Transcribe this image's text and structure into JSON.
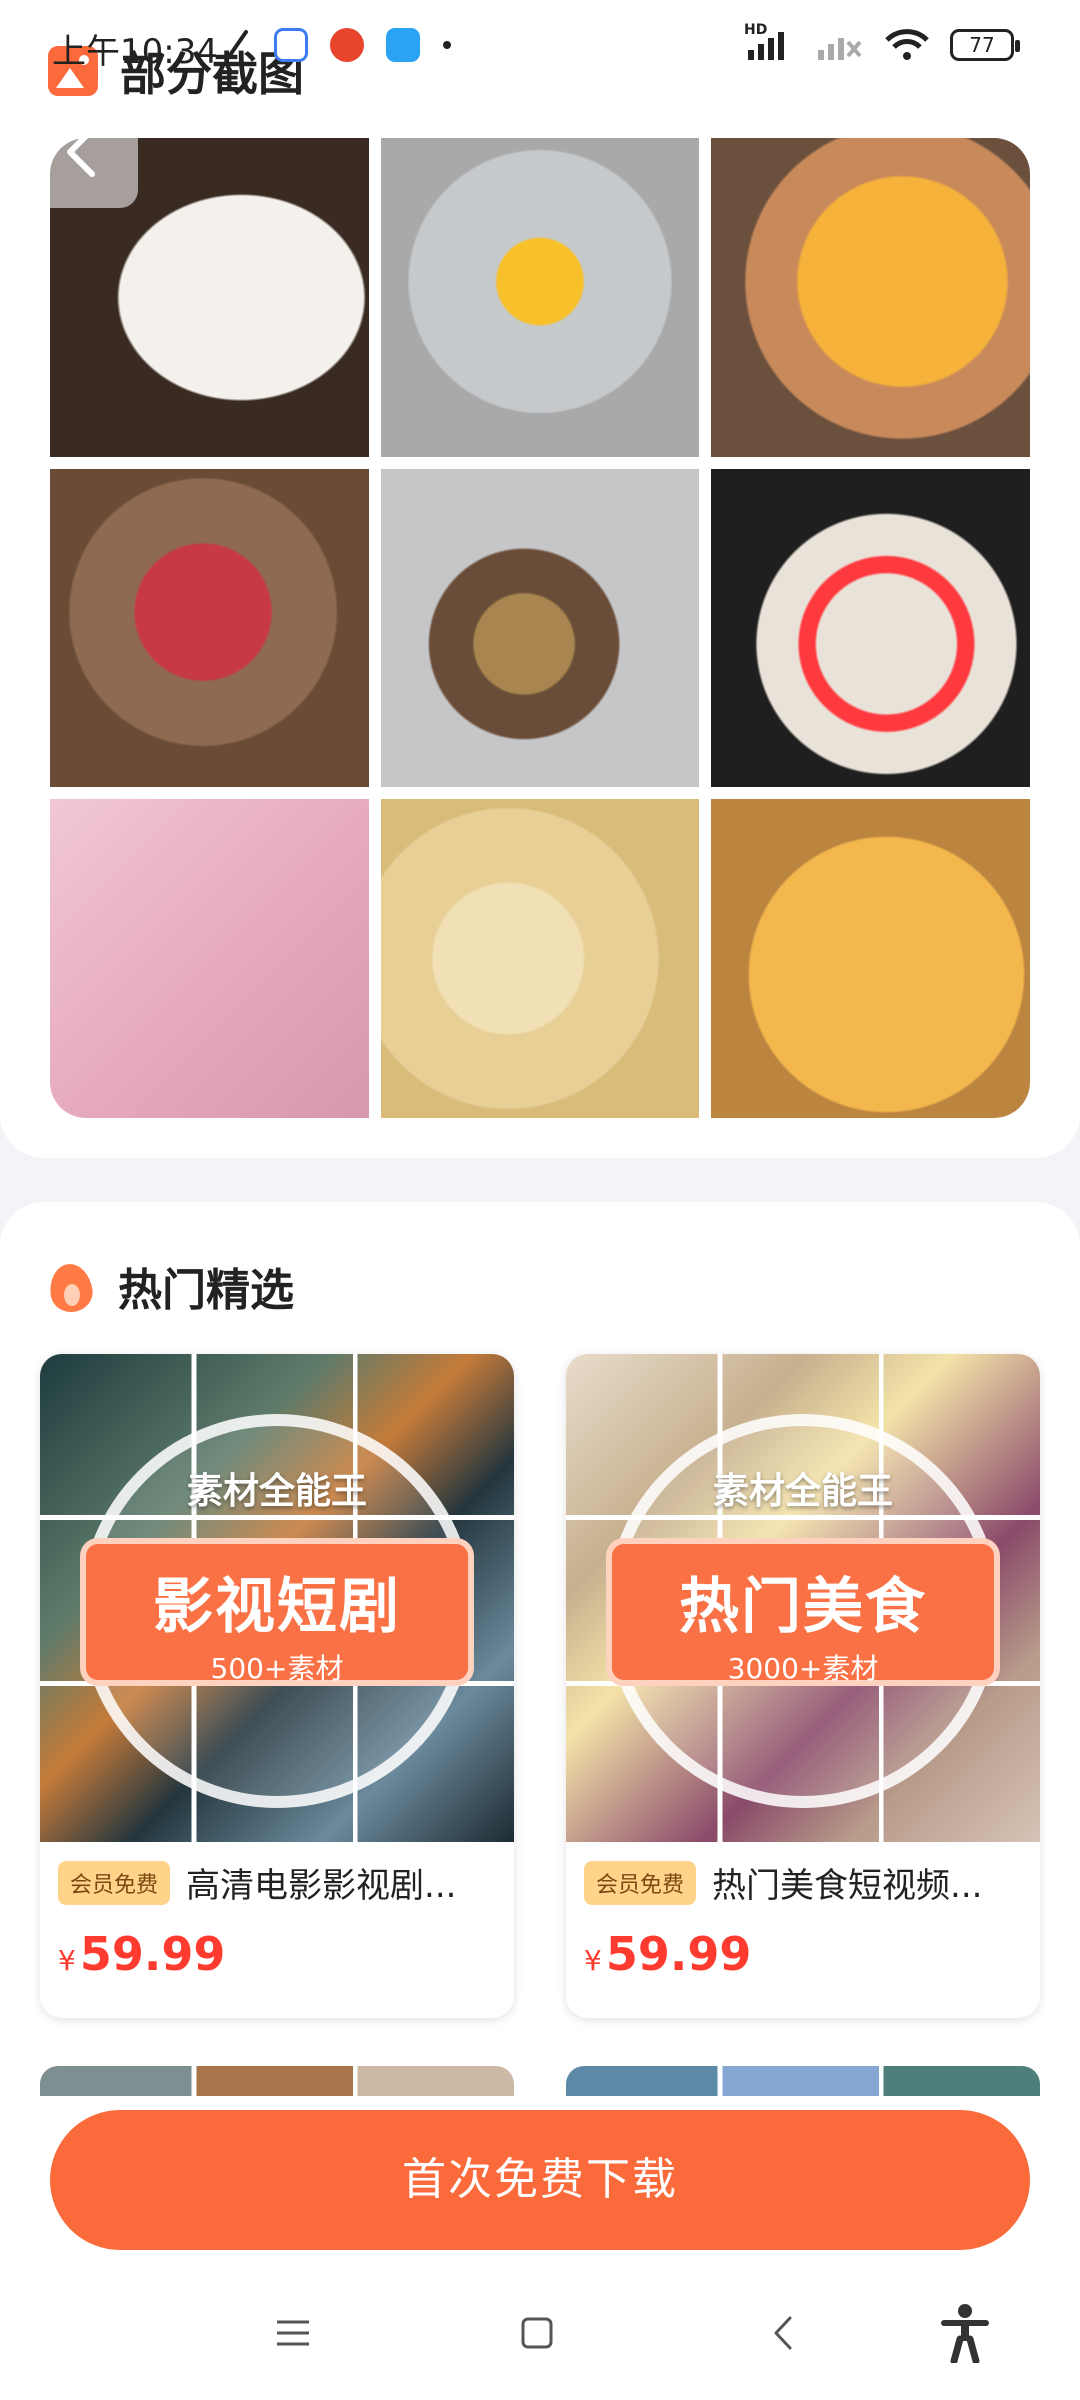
{
  "status_bar": {
    "time": "上午10:34",
    "battery": "77",
    "network_label": "HD"
  },
  "top_section": {
    "title": "部分截图"
  },
  "hot_section": {
    "title": "热门精选",
    "products": [
      {
        "cover_brand": "素材全能王",
        "cover_title": "影视短剧",
        "cover_sub": "500+素材",
        "badge": "会员免费",
        "title": "高清电影影视剧...",
        "currency": "¥",
        "price": "59.99"
      },
      {
        "cover_brand": "素材全能王",
        "cover_title": "热门美食",
        "cover_sub": "3000+素材",
        "badge": "会员免费",
        "title": "热门美食短视频...",
        "currency": "¥",
        "price": "59.99"
      }
    ]
  },
  "cta": {
    "download_label": "首次免费下载"
  },
  "colors": {
    "accent": "#fb6a3a",
    "price": "#ff3b30",
    "badge_bg": "#ffd38a"
  }
}
